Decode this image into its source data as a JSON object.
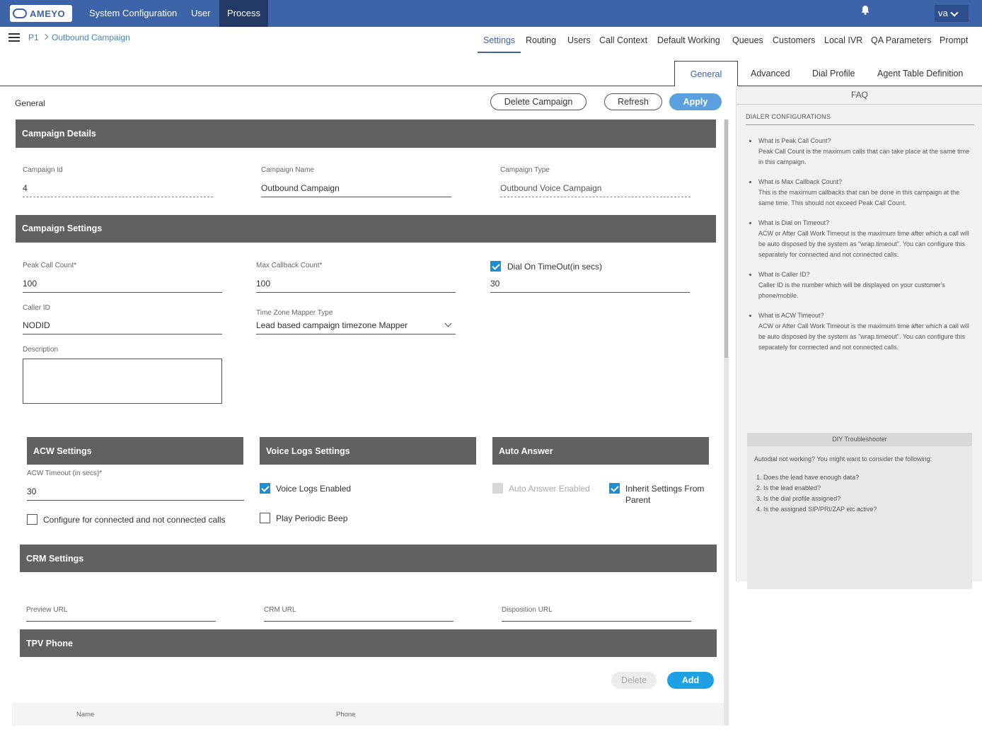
{
  "topbar": {
    "logo_text": "AMEYO",
    "nav": [
      "System Configuration",
      "User",
      "Process"
    ],
    "active_nav": "Process",
    "user": "va"
  },
  "breadcrumb": {
    "root": "P1",
    "current": "Outbound Campaign"
  },
  "tabs_primary": [
    "Settings",
    "Routing",
    "Users",
    "Call Context",
    "Default Working",
    "Queues",
    "Customers",
    "Local IVR",
    "QA Parameters",
    "Prompt"
  ],
  "tabs_secondary": [
    "General",
    "Advanced",
    "Dial Profile",
    "Agent Table Definition"
  ],
  "pane": {
    "title": "General",
    "delete_label": "Delete Campaign",
    "refresh_label": "Refresh",
    "apply_label": "Apply"
  },
  "campaign_details": {
    "title": "Campaign Details",
    "id_label": "Campaign Id",
    "id_value": "4",
    "name_label": "Campaign Name",
    "name_value": "Outbound Campaign",
    "type_label": "Campaign Type",
    "type_value": "Outbound Voice Campaign"
  },
  "campaign_settings": {
    "title": "Campaign Settings",
    "peak_label": "Peak Call Count*",
    "peak_value": "100",
    "max_cb_label": "Max Callback Count*",
    "max_cb_value": "100",
    "dial_timeout_label": "Dial On TimeOut(in secs)",
    "dial_timeout_value": "30",
    "caller_id_label": "Caller ID",
    "caller_id_value": "NODID",
    "tz_label": "Time Zone Mapper Type",
    "tz_value": "Lead based campaign timezone Mapper",
    "desc_label": "Description"
  },
  "acw": {
    "title": "ACW Settings",
    "timeout_label": "ACW Timeout (in secs)*",
    "timeout_value": "30",
    "configure_label": "Configure for connected and not connected calls"
  },
  "voice_logs": {
    "title": "Voice Logs Settings",
    "enabled_label": "Voice Logs Enabled",
    "beep_label": "Play Periodic Beep"
  },
  "auto_answer": {
    "title": "Auto Answer",
    "enabled_label": "Auto Answer Enabled",
    "inherit_label_1": "Inherit Settings From",
    "inherit_label_2": "Parent"
  },
  "crm": {
    "title": "CRM Settings",
    "preview_label": "Preview URL",
    "crm_label": "CRM URL",
    "disposition_label": "Disposition URL"
  },
  "tpv": {
    "title": "TPV Phone",
    "delete_label": "Delete",
    "add_label": "Add",
    "col_name": "Name",
    "col_phone": "Phone"
  },
  "faq": {
    "title": "FAQ",
    "subtitle": "DIALER CONFIGURATIONS",
    "items": [
      {
        "q": "What is Peak Call Count?",
        "a": "Peak Call Count is the maximum calls that can take place at the same time in this campaign."
      },
      {
        "q": "What is Max Callback Count?",
        "a": "This is the maximum callbacks that can be done in this campaign at the same time. This should not exceed Peak Call Count."
      },
      {
        "q": "What is Dial on Timeout?",
        "a": "ACW or After Call Work Timeout is the maximum time after which a call will be auto disposed by the system as \"wrap.timeout\". You can configure this separately for connected and not connected calls."
      },
      {
        "q": "What is Caller ID?",
        "a": "Caller ID is the number which will be displayed on your customer's phone/mobile."
      },
      {
        "q": "What is ACW Timeout?",
        "a": "ACW or After Call Work Timeout is the maximum time after which a call will be auto disposed by the system as \"wrap.timeout\". You can configure this separately for connected and not connected calls."
      }
    ]
  },
  "diy": {
    "title": "DIY Troubleshooter",
    "intro": "Autodial not working? You might want to consider the following:",
    "items": [
      "1. Does the lead have enough data?",
      "2. Is the lead enabled?",
      "3. Is the dial profile assigned?",
      "4. Is the assigned SIP/PRI/ZAP etc active?"
    ]
  }
}
